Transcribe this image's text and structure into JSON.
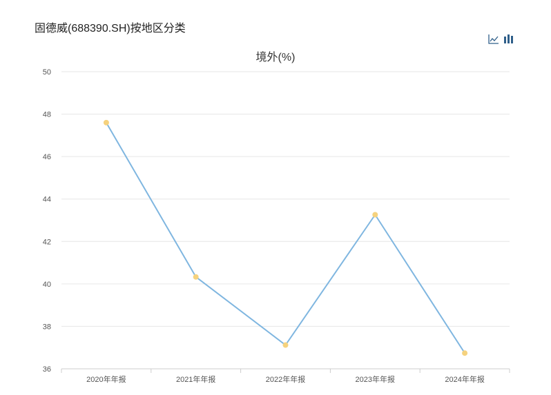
{
  "page": {
    "title": "固德威(688390.SH)按地区分类"
  },
  "toolbar": {
    "icons": [
      "line-chart-icon",
      "bar-chart-icon"
    ]
  },
  "colors": {
    "line": "#7fb6e0",
    "point": "#f5d27e",
    "grid": "#e6e6e6",
    "axis": "#cccccc"
  },
  "chart_data": {
    "type": "line",
    "title": "境外(%)",
    "xlabel": "",
    "ylabel": "",
    "categories": [
      "2020年年报",
      "2021年年报",
      "2022年年报",
      "2023年年报",
      "2024年年报"
    ],
    "series": [
      {
        "values": [
          47.6,
          40.33,
          37.12,
          43.26,
          36.74
        ]
      }
    ],
    "ylim": [
      36,
      50
    ],
    "yticks": [
      36,
      38,
      40,
      42,
      44,
      46,
      48,
      50
    ],
    "grid": true,
    "legend": "none"
  }
}
